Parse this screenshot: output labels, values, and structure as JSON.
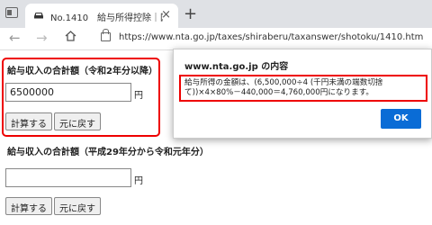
{
  "tab": {
    "title": "No.1410　給与所得控除｜国税庁",
    "close": "×",
    "new_tab": "+"
  },
  "toolbar": {
    "back": "←",
    "forward": "→",
    "url": "https://www.nta.go.jp/taxes/shiraberu/taxanswer/shotoku/1410.htm"
  },
  "section1": {
    "heading": "給与収入の合計額（令和2年分以降）",
    "input_value": "6500000",
    "unit": "円",
    "calc_label": "計算する",
    "back_label": "元に戻す"
  },
  "section2": {
    "heading": "給与収入の合計額（平成29年分から令和元年分）",
    "input_value": "",
    "unit": "円",
    "calc_label": "計算する",
    "back_label": "元に戻す"
  },
  "dialog": {
    "title": "www.nta.go.jp の内容",
    "message": "給与所得の金額は、(6,500,000÷4 (千円未満の端数切捨て))×4×80%－440,000＝4,760,000円になります。",
    "ok_label": "OK"
  },
  "colors": {
    "highlight": "#e00000",
    "ok_button": "#0a6cd6"
  }
}
